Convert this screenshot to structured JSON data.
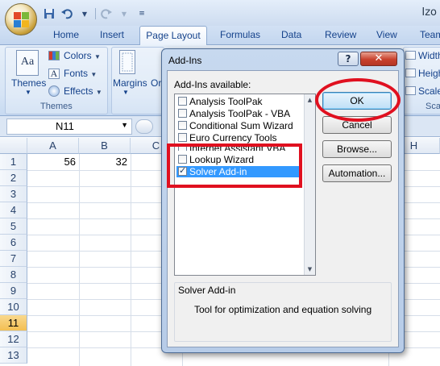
{
  "title_bar": {
    "app_title": "Izo",
    "qat": [
      "save-icon",
      "undo-icon",
      "redo-icon",
      "customize-icon"
    ]
  },
  "tabs": [
    {
      "label": "Home",
      "active": false
    },
    {
      "label": "Insert",
      "active": false
    },
    {
      "label": "Page Layout",
      "active": true
    },
    {
      "label": "Formulas",
      "active": false
    },
    {
      "label": "Data",
      "active": false
    },
    {
      "label": "Review",
      "active": false
    },
    {
      "label": "View",
      "active": false
    },
    {
      "label": "Team",
      "active": false
    }
  ],
  "ribbon": {
    "themes_label": "Themes",
    "colors_label": "Colors",
    "fonts_label": "Fonts",
    "effects_label": "Effects",
    "group_themes": "Themes",
    "margins_label": "Margins",
    "orientation_partial": "Or",
    "width_label": "Width",
    "height_label": "Heigh",
    "scale_label": "Scale",
    "scale_group_partial": "Sca"
  },
  "formula_bar": {
    "name_box": "N11"
  },
  "grid": {
    "columns": [
      "A",
      "B",
      "C",
      "H"
    ],
    "rows": [
      "1",
      "2",
      "3",
      "4",
      "5",
      "6",
      "7",
      "8",
      "9",
      "10",
      "11",
      "12",
      "13"
    ],
    "selected_row": "11",
    "cells": {
      "A1": "56",
      "B1": "32"
    }
  },
  "dialog": {
    "title": "Add-Ins",
    "help_label": "?",
    "close_label": "✕",
    "available_label": "Add-Ins available:",
    "addins": [
      {
        "label": "Analysis ToolPak",
        "checked": false,
        "selected": false
      },
      {
        "label": "Analysis ToolPak - VBA",
        "checked": false,
        "selected": false
      },
      {
        "label": "Conditional Sum Wizard",
        "checked": false,
        "selected": false
      },
      {
        "label": "Euro Currency Tools",
        "checked": false,
        "selected": false
      },
      {
        "label": "Internet Assistant VBA",
        "checked": false,
        "selected": false
      },
      {
        "label": "Lookup Wizard",
        "checked": false,
        "selected": false
      },
      {
        "label": "Solver Add-in",
        "checked": true,
        "selected": true
      }
    ],
    "ok_label": "OK",
    "cancel_label": "Cancel",
    "browse_label": "Browse...",
    "automation_label": "Automation...",
    "desc_title": "Solver Add-in",
    "desc_text": "Tool for optimization and equation solving"
  },
  "annotations": {
    "color": "#e0101f"
  }
}
